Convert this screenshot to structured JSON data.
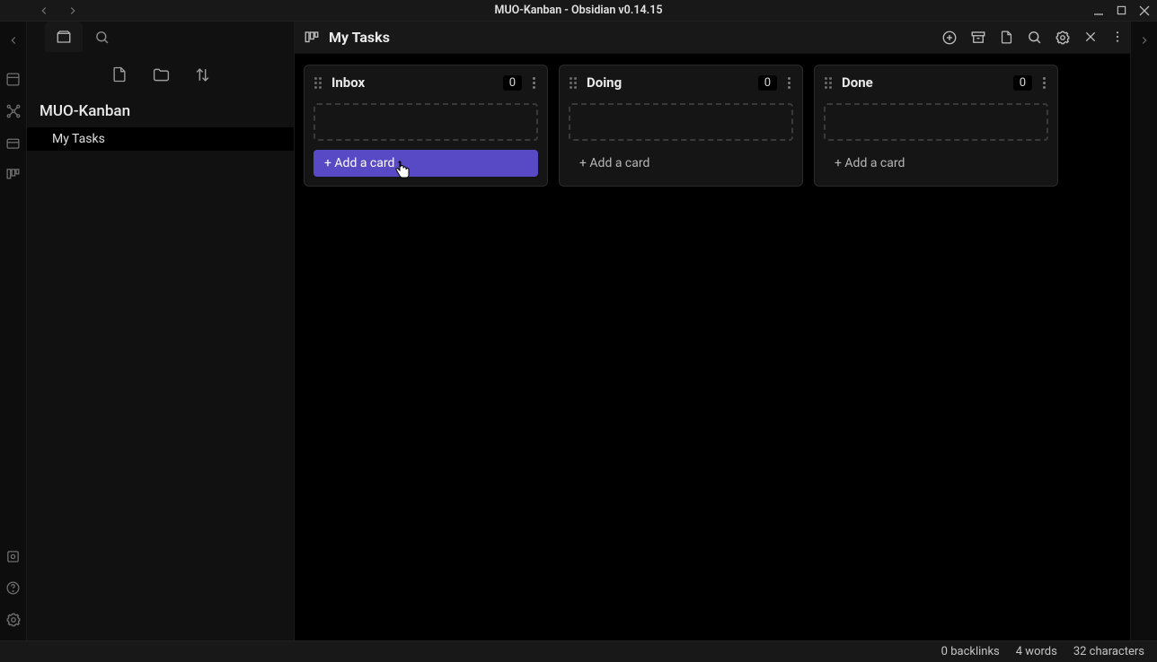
{
  "window": {
    "title": "MUO-Kanban - Obsidian v0.14.15"
  },
  "sidebar": {
    "vault_name": "MUO-Kanban",
    "files": [
      {
        "name": "My Tasks"
      }
    ]
  },
  "pane": {
    "title": "My Tasks"
  },
  "board": {
    "lanes": [
      {
        "title": "Inbox",
        "count": "0",
        "add_label": "+ Add a card",
        "active": true
      },
      {
        "title": "Doing",
        "count": "0",
        "add_label": "+ Add a card",
        "active": false
      },
      {
        "title": "Done",
        "count": "0",
        "add_label": "+ Add a card",
        "active": false
      }
    ]
  },
  "statusbar": {
    "backlinks": "0 backlinks",
    "words": "4 words",
    "characters": "32 characters"
  }
}
